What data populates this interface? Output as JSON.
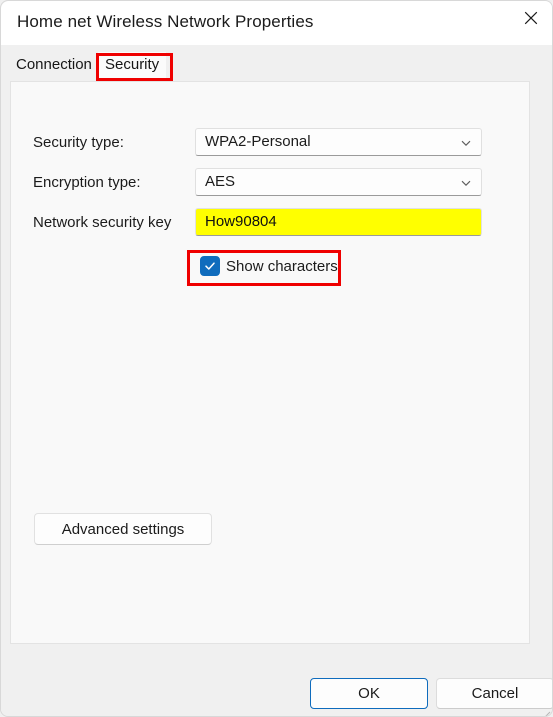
{
  "window": {
    "title": "Home net Wireless Network Properties",
    "close_icon": "close-icon"
  },
  "tabs": [
    {
      "label": "Connection",
      "selected": false
    },
    {
      "label": "Security",
      "selected": true
    }
  ],
  "form": {
    "security_type": {
      "label": "Security type:",
      "value": "WPA2-Personal",
      "chevron_icon": "chevron-down-icon"
    },
    "encryption_type": {
      "label": "Encryption type:",
      "value": "AES",
      "chevron_icon": "chevron-down-icon"
    },
    "security_key": {
      "label": "Network security key",
      "value": "How90804",
      "highlight_color": "#ffff00"
    },
    "show_characters": {
      "label": "Show characters",
      "checked": true,
      "check_icon": "checkmark-icon",
      "accent_color": "#0f6cbd"
    }
  },
  "buttons": {
    "advanced_settings": "Advanced settings",
    "ok": "OK",
    "cancel": "Cancel"
  },
  "annotations": {
    "color": "#ef0000",
    "targets": [
      "Security",
      "Show characters"
    ]
  }
}
